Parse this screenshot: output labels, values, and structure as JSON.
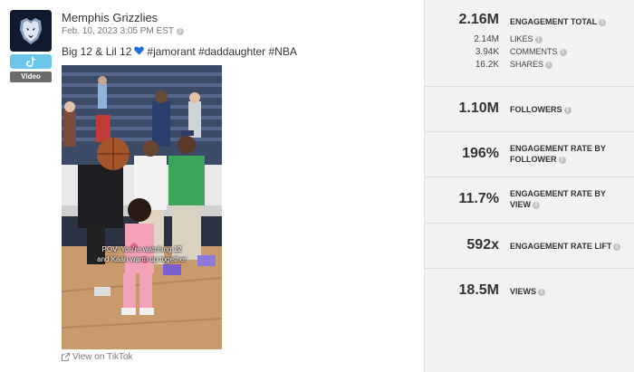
{
  "account": {
    "name": "Memphis Grizzlies",
    "date": "Feb. 10, 2023 3:05 PM EST",
    "platform_icon": "tiktok-icon",
    "post_type": "Video"
  },
  "post": {
    "caption_before": "Big 12 & Lil 12",
    "caption_emoji": "💙",
    "caption_after": "#jamorant #daddaughter #NBA",
    "overlay_line1": "POV: You're watching 12",
    "overlay_line2": "and Kaari warm up together"
  },
  "link": {
    "label": "View on TikTok"
  },
  "metrics": {
    "engagement_total": {
      "value": "2.16M",
      "label": "ENGAGEMENT TOTAL"
    },
    "breakdown": [
      {
        "value": "2.14M",
        "label": "LIKES"
      },
      {
        "value": "3.94K",
        "label": "COMMENTS"
      },
      {
        "value": "16.2K",
        "label": "SHARES"
      }
    ],
    "followers": {
      "value": "1.10M",
      "label": "FOLLOWERS"
    },
    "er_follower": {
      "value": "196%",
      "label_line1": "ENGAGEMENT RATE BY",
      "label_line2": "FOLLOWER"
    },
    "er_view": {
      "value": "11.7%",
      "label_line1": "ENGAGEMENT RATE BY",
      "label_line2": "VIEW"
    },
    "er_lift": {
      "value": "592x",
      "label": "ENGAGEMENT RATE LIFT"
    },
    "views": {
      "value": "18.5M",
      "label": "VIEWS"
    }
  },
  "colors": {
    "panel_bg": "#f2f2f2",
    "tiktok_badge": "#6cc6ec",
    "type_badge": "#6b6b6b",
    "avatar_bg": "#0f1a2e"
  }
}
